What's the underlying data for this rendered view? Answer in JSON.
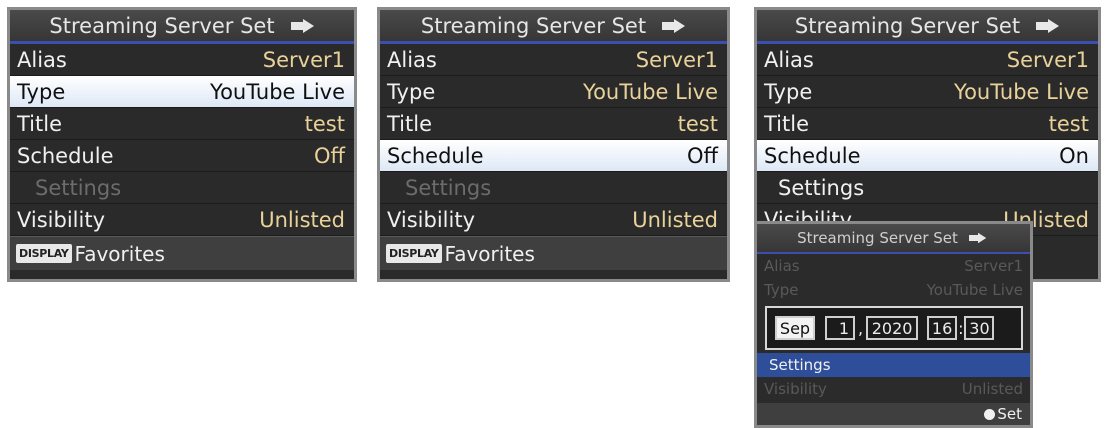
{
  "panel1": {
    "title": "Streaming Server Set",
    "rows": [
      {
        "label": "Alias",
        "value": "Server1"
      },
      {
        "label": "Type",
        "value": "YouTube Live"
      },
      {
        "label": "Title",
        "value": "test"
      },
      {
        "label": "Schedule",
        "value": "Off"
      },
      {
        "label": "Settings",
        "value": ""
      },
      {
        "label": "Visibility",
        "value": "Unlisted"
      }
    ],
    "footer_badge": "DISPLAY",
    "footer_label": "Favorites"
  },
  "panel2": {
    "title": "Streaming Server Set",
    "rows": [
      {
        "label": "Alias",
        "value": "Server1"
      },
      {
        "label": "Type",
        "value": "YouTube Live"
      },
      {
        "label": "Title",
        "value": "test"
      },
      {
        "label": "Schedule",
        "value": "Off"
      },
      {
        "label": "Settings",
        "value": ""
      },
      {
        "label": "Visibility",
        "value": "Unlisted"
      }
    ],
    "footer_badge": "DISPLAY",
    "footer_label": "Favorites"
  },
  "panel3": {
    "title": "Streaming Server Set",
    "rows": [
      {
        "label": "Alias",
        "value": "Server1"
      },
      {
        "label": "Type",
        "value": "YouTube Live"
      },
      {
        "label": "Title",
        "value": "test"
      },
      {
        "label": "Schedule",
        "value": "On"
      },
      {
        "label": "Settings",
        "value": ""
      },
      {
        "label": "Visibility",
        "value": "Unlisted"
      }
    ]
  },
  "overlay": {
    "title": "Streaming Server Set",
    "rows": [
      {
        "label": "Alias",
        "value": "Server1"
      },
      {
        "label": "Type",
        "value": "YouTube Live"
      },
      {
        "label": "Settings",
        "value": ""
      },
      {
        "label": "Visibility",
        "value": "Unlisted"
      }
    ],
    "date": {
      "month": "Sep",
      "day": "1",
      "comma": ",",
      "year": "2020",
      "hour": "16",
      "colon": ":",
      "minute": "30"
    },
    "footer_label": "Set"
  },
  "colors": {
    "accent": "#3c4fae",
    "value": "#e9d29a",
    "highlight": "#2f4e9a"
  }
}
